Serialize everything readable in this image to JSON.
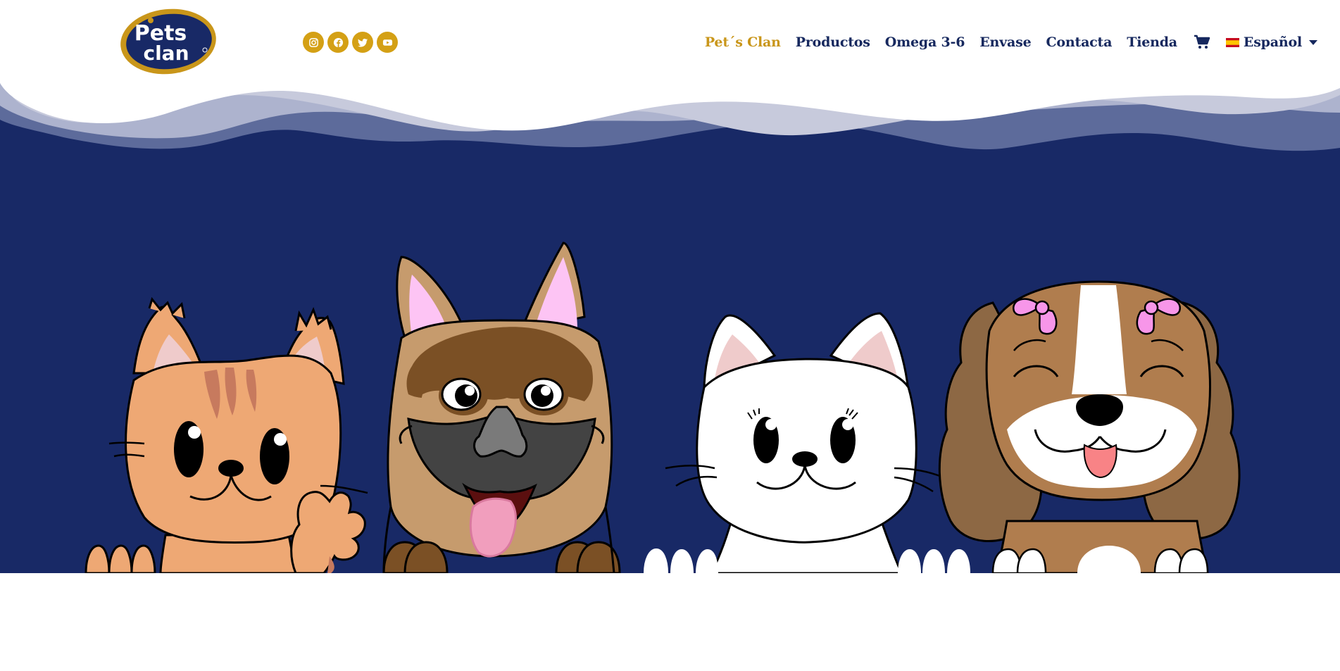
{
  "brand": {
    "logo_text_1": "Pets",
    "logo_text_2": "clan"
  },
  "social": [
    {
      "name": "instagram-icon"
    },
    {
      "name": "facebook-icon"
    },
    {
      "name": "twitter-icon"
    },
    {
      "name": "youtube-icon"
    }
  ],
  "nav": {
    "items": [
      "Pet´s Clan",
      "Productos",
      "Omega 3-6",
      "Envase",
      "Contacta",
      "Tienda"
    ],
    "active_index": 0,
    "language": "Español"
  },
  "colors": {
    "navy": "#16285e",
    "gold": "#d4a015",
    "gold_active": "#c9961a",
    "hero_bg": "#182966"
  }
}
